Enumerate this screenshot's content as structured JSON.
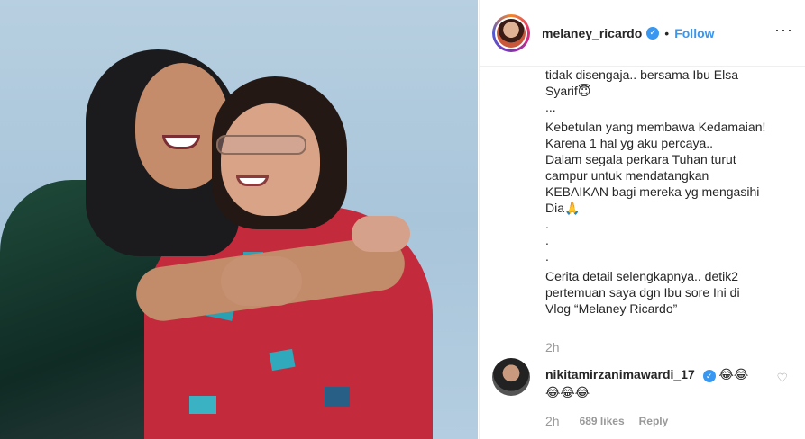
{
  "post": {
    "username": "melaney_ricardo",
    "verified_icon": "verified-badge-icon",
    "dot": "•",
    "follow_label": "Follow",
    "more_icon": "···"
  },
  "caption": {
    "lines": [
      "tidak disengaja.. bersama Ibu Elsa",
      "Syarif😇",
      "...",
      "Kebetulan yang membawa Kedamaian!",
      "Karena 1 hal yg aku percaya..",
      "Dalam segala perkara Tuhan turut",
      "campur untuk mendatangkan",
      "KEBAIKAN bagi mereka yg mengasihi",
      "Dia🙏",
      ".",
      ".",
      ".",
      "Cerita detail selengkapnya.. detik2",
      "pertemuan saya dgn Ibu sore Ini di",
      "Vlog “Melaney Ricardo”"
    ],
    "time": "2h"
  },
  "comment": {
    "username": "nikitamirzanimawardi_17",
    "text_line1": "😂😂",
    "text_line2": "😂😂😂",
    "verified_icon": "verified-badge-icon",
    "time": "2h",
    "likes": "689 likes",
    "reply_label": "Reply"
  }
}
